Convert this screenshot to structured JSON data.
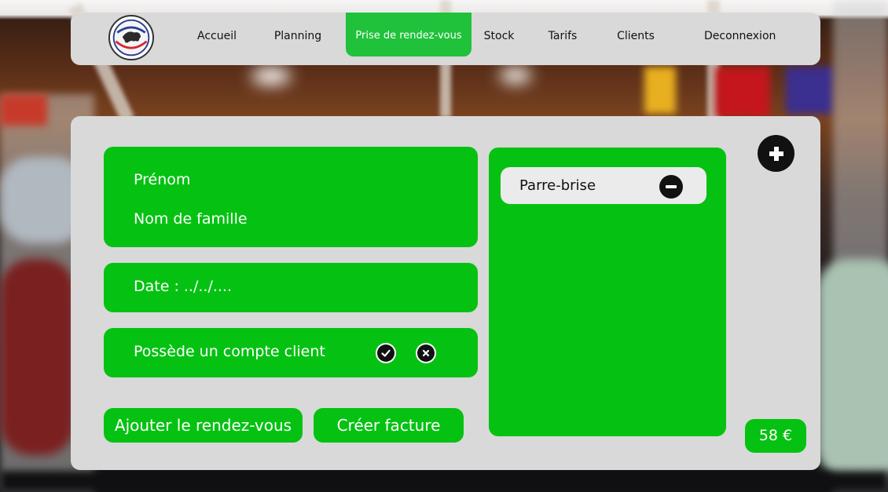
{
  "nav": {
    "items": [
      {
        "label": "Accueil"
      },
      {
        "label": "Planning"
      },
      {
        "label": "Prise de rendez-vous",
        "active": true
      },
      {
        "label": "Stock"
      },
      {
        "label": "Tarifs"
      },
      {
        "label": "Clients"
      },
      {
        "label": "Deconnexion"
      }
    ]
  },
  "form": {
    "first_name_placeholder": "Prénom",
    "last_name_placeholder": "Nom de famille",
    "date_placeholder": "Date : ../../....",
    "has_account_label": "Possède un compte client"
  },
  "actions": {
    "add_appointment": "Ajouter le rendez-vous",
    "create_invoice": "Créer facture"
  },
  "services": {
    "items": [
      {
        "label": "Parre-brise"
      }
    ]
  },
  "total": "58 €",
  "icons": {
    "add": "plus-circle-icon",
    "remove": "minus-circle-icon",
    "yes": "check-circle-icon",
    "no": "x-circle-icon"
  },
  "colors": {
    "accent": "#05c212",
    "panel": "#d9d9d9",
    "nav_active": "#1fc23a"
  }
}
